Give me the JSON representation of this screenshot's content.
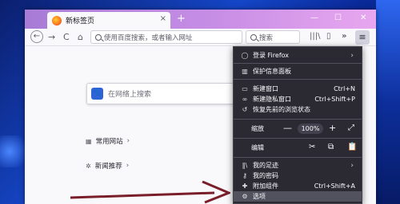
{
  "tab": {
    "title": "新标签页",
    "close": "×"
  },
  "titlebar": {
    "new_tab": "+",
    "minimize": "—",
    "maximize": "☐",
    "close": "✕"
  },
  "navbar": {
    "back": "←",
    "forward": "→",
    "reload": "C",
    "home": "⌂",
    "url_placeholder": "使用百度搜索，或者输入网址",
    "search_placeholder": "搜索",
    "library": "|||\\",
    "sidebar": "▯",
    "overflow": "»",
    "menu": "≡"
  },
  "content": {
    "search_placeholder": "在网络上搜索",
    "top_sites": "常用网站",
    "recommended": "新闻推荐"
  },
  "menu": {
    "sign_in": "登录 Firefox",
    "protections": "保护信息面板",
    "new_window": "新建窗口",
    "new_window_shortcut": "Ctrl+N",
    "new_private": "新建隐私窗口",
    "new_private_shortcut": "Ctrl+Shift+P",
    "restore_session": "恢复先前的浏览状态",
    "zoom_label": "缩放",
    "zoom_minus": "—",
    "zoom_value": "100%",
    "zoom_plus": "+",
    "edit_label": "编辑",
    "library": "我的足迹",
    "passwords": "我的密码",
    "addons": "附加组件",
    "addons_shortcut": "Ctrl+Shift+A",
    "options": "选项"
  }
}
